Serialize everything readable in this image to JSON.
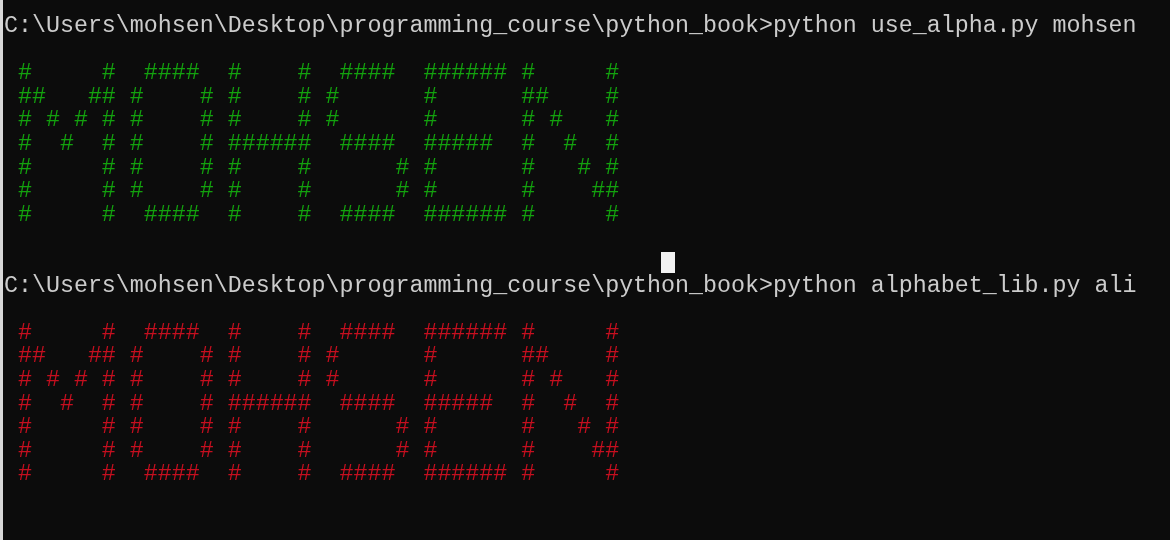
{
  "terminal": {
    "blocks": [
      {
        "prompt": "C:\\Users\\mohsen\\Desktop\\programming_course\\python_book>python use_alpha.py mohsen",
        "color": "#13a10e",
        "art": [
          " #     #  ####  #    #  ####  ###### #     #",
          " ##   ## #    # #    # #      #      ##    #",
          " # # # # #    # #    # #      #      # #   #",
          " #  #  # #    # ######  ####  #####  #  #  #",
          " #     # #    # #    #      # #      #   # #",
          " #     # #    # #    #      # #      #    ##",
          " #     #  ####  #    #  ####  ###### #     #"
        ]
      },
      {
        "prompt": "C:\\Users\\mohsen\\Desktop\\programming_course\\python_book>python alphabet_lib.py ali",
        "color": "#c50f1f",
        "art": [
          " #     #  ####  #    #  ####  ###### #     #",
          " ##   ## #    # #    # #      #      ##    #",
          " # # # # #    # #    # #      #      # #   #",
          " #  #  # #    # ######  ####  #####  #  #  #",
          " #     # #    # #    #      # #      #   # #",
          " #     # #    # #    #      # #      #    ##",
          " #     #  ####  #    #  ####  ###### #     #"
        ]
      }
    ]
  }
}
